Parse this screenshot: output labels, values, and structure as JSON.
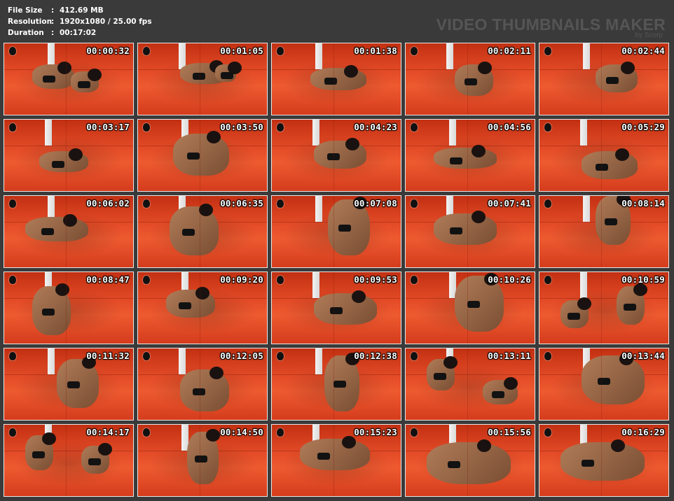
{
  "info": {
    "file_size": {
      "label": "File Size",
      "value": "412.69 MB"
    },
    "resolution": {
      "label": "Resolution",
      "value": "1920x1080 / 25.00 fps"
    },
    "duration": {
      "label": "Duration",
      "value": "00:17:02"
    }
  },
  "watermark": {
    "title": "VIDEO THUMBNAILS MAKER",
    "subtitle": "by Scorp"
  },
  "thumbnails": [
    {
      "time": "00:00:32"
    },
    {
      "time": "00:01:05"
    },
    {
      "time": "00:01:38"
    },
    {
      "time": "00:02:11"
    },
    {
      "time": "00:02:44"
    },
    {
      "time": "00:03:17"
    },
    {
      "time": "00:03:50"
    },
    {
      "time": "00:04:23"
    },
    {
      "time": "00:04:56"
    },
    {
      "time": "00:05:29"
    },
    {
      "time": "00:06:02"
    },
    {
      "time": "00:06:35"
    },
    {
      "time": "00:07:08"
    },
    {
      "time": "00:07:41"
    },
    {
      "time": "00:08:14"
    },
    {
      "time": "00:08:47"
    },
    {
      "time": "00:09:20"
    },
    {
      "time": "00:09:53"
    },
    {
      "time": "00:10:26"
    },
    {
      "time": "00:10:59"
    },
    {
      "time": "00:11:32"
    },
    {
      "time": "00:12:05"
    },
    {
      "time": "00:12:38"
    },
    {
      "time": "00:13:11"
    },
    {
      "time": "00:13:44"
    },
    {
      "time": "00:14:17"
    },
    {
      "time": "00:14:50"
    },
    {
      "time": "00:15:23"
    },
    {
      "time": "00:15:56"
    },
    {
      "time": "00:16:29"
    }
  ],
  "icons": {
    "channel_logo": "channel-logo-icon"
  },
  "colors": {
    "background": "#3a3a3a",
    "mat": "#e24a26",
    "watermark": "#555555"
  }
}
